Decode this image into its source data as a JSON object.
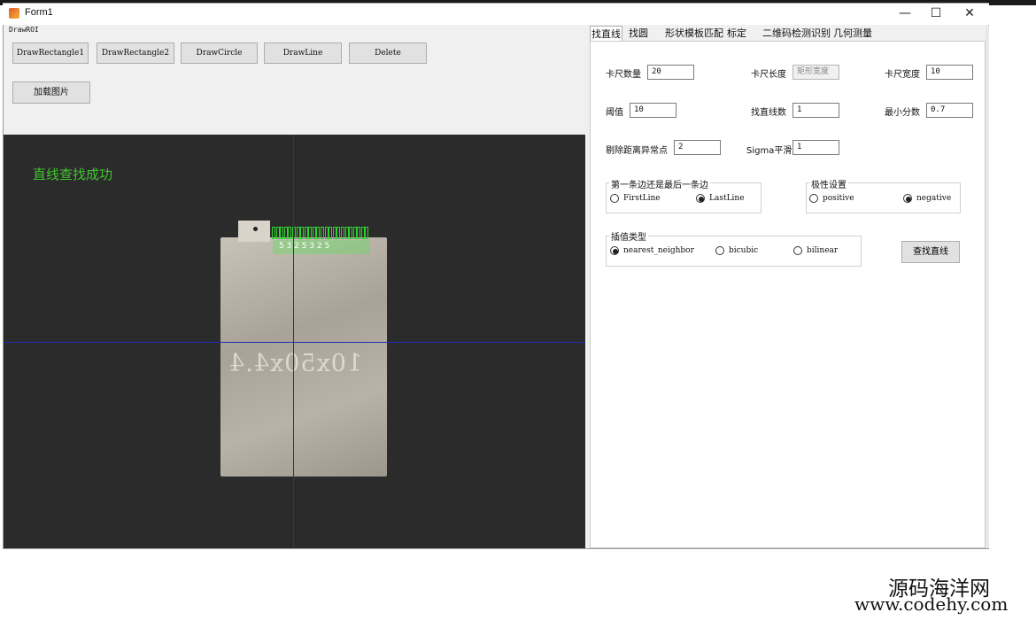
{
  "window": {
    "title": "Form1",
    "minimize_glyph": "—",
    "maximize_glyph": "☐",
    "close_glyph": "✕"
  },
  "menu": {
    "label": "DrawROI"
  },
  "toolbar": {
    "draw_rectangle1": "DrawRectangle1",
    "draw_rectangle2": "DrawRectangle2",
    "draw_circle": "DrawCircle",
    "draw_line": "DrawLine",
    "delete": "Delete",
    "load_image": "加载图片"
  },
  "canvas": {
    "status_message": "直线查找成功",
    "battery_marking": "10x50x4.4",
    "roi_label": "5  3  2  5  3  2  5",
    "roi_count": 24
  },
  "tabs": [
    {
      "label": "找直线",
      "active": true
    },
    {
      "label": "找圆",
      "active": false
    },
    {
      "label": "形状模板匹配",
      "active": false
    },
    {
      "label": "标定",
      "active": false
    },
    {
      "label": "二维码检测识别",
      "active": false
    },
    {
      "label": "几何测量",
      "active": false
    }
  ],
  "params": {
    "caliper_count_label": "卡尺数量",
    "caliper_count": "20",
    "caliper_length_label": "卡尺长度",
    "caliper_length_placeholder": "矩形宽度",
    "caliper_width_label": "卡尺宽度",
    "caliper_width": "10",
    "threshold_label": "阈值",
    "threshold": "10",
    "line_count_label": "找直线数",
    "line_count": "1",
    "min_score_label": "最小分数",
    "min_score": "0.7",
    "outlier_label": "剔除距离异常点",
    "outlier": "2",
    "sigma_label": "Sigma平滑",
    "sigma": "1"
  },
  "edge_group": {
    "title": "第一条边还是最后一条边",
    "options": [
      "FirstLine",
      "LastLine"
    ],
    "selected": "LastLine"
  },
  "polarity_group": {
    "title": "极性设置",
    "options": [
      "positive",
      "negative"
    ],
    "selected": "negative"
  },
  "interp_group": {
    "title": "插值类型",
    "options": [
      "nearest_neighbor",
      "bicubic",
      "bilinear"
    ],
    "selected": "nearest_neighbor"
  },
  "find_line_button": "查找直线",
  "watermark": {
    "cn": "源码海洋网",
    "en": "www.codehy.com"
  }
}
